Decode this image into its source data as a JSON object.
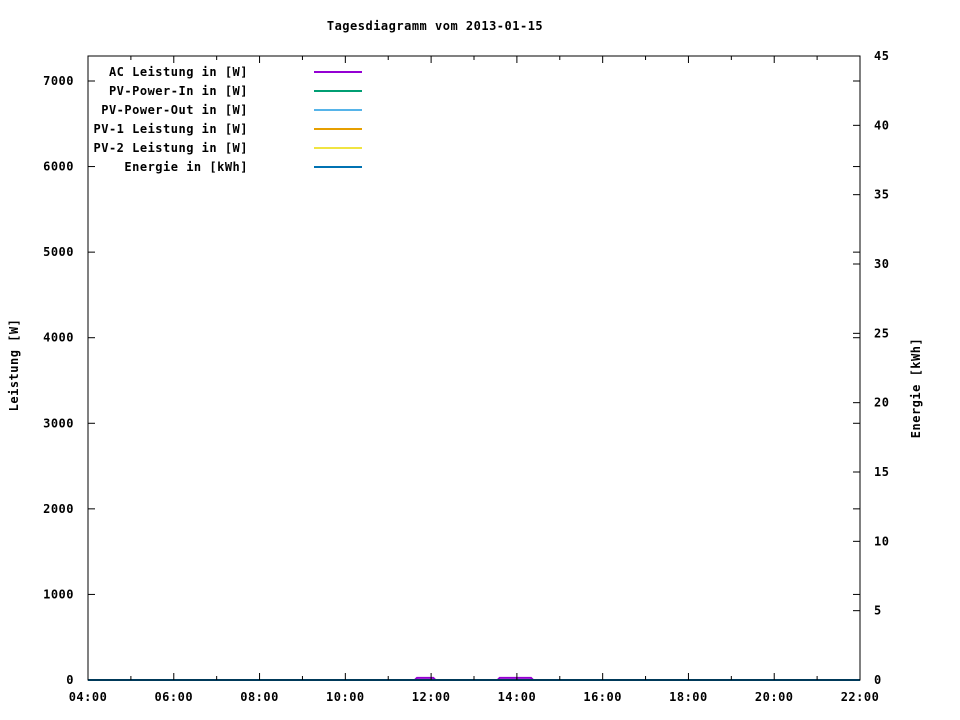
{
  "page": {
    "background": "#ffffff",
    "text_color": "#000000"
  },
  "chart_data": {
    "type": "line",
    "title": "Tagesdiagramm vom 2013-01-15",
    "ylabel": "Leistung [W]",
    "y2label": "Energie [kWh]",
    "grid": false,
    "legend_position": "top-left-inside",
    "x_axis": {
      "unit": "time",
      "start_hour": 4,
      "end_hour": 22,
      "major_step_hours": 2,
      "minor_step_hours": 1,
      "major_tick_labels": [
        "04:00",
        "06:00",
        "08:00",
        "10:00",
        "12:00",
        "14:00",
        "16:00",
        "18:00",
        "20:00",
        "22:00"
      ]
    },
    "y_axis": {
      "min": 0,
      "max": 7292,
      "tick_values": [
        0,
        1000,
        2000,
        3000,
        4000,
        5000,
        6000,
        7000
      ],
      "tick_labels": [
        "0",
        "1000",
        "2000",
        "3000",
        "4000",
        "5000",
        "6000",
        "7000"
      ]
    },
    "y2_axis": {
      "min": 0,
      "max": 45,
      "tick_values": [
        0,
        5,
        10,
        15,
        20,
        25,
        30,
        35,
        40,
        45
      ],
      "tick_labels": [
        "0",
        "5",
        "10",
        "15",
        "20",
        "25",
        "30",
        "35",
        "40",
        "45"
      ]
    },
    "series": [
      {
        "label": "AC Leistung in [W]",
        "color": "#9400d3",
        "axis": "y1",
        "points": [
          [
            4,
            0
          ],
          [
            11.62,
            0
          ],
          [
            11.67,
            25
          ],
          [
            12.05,
            25
          ],
          [
            12.1,
            0
          ],
          [
            13.55,
            0
          ],
          [
            13.6,
            25
          ],
          [
            14.33,
            25
          ],
          [
            14.38,
            0
          ],
          [
            22,
            0
          ]
        ]
      },
      {
        "label": "PV-Power-In in [W]",
        "color": "#009e73",
        "axis": "y1",
        "points": [
          [
            4,
            0
          ],
          [
            22,
            0
          ]
        ]
      },
      {
        "label": "PV-Power-Out in [W]",
        "color": "#56b4e9",
        "axis": "y1",
        "points": [
          [
            4,
            0
          ],
          [
            22,
            0
          ]
        ]
      },
      {
        "label": "PV-1 Leistung in [W]",
        "color": "#e69f00",
        "axis": "y1",
        "points": [
          [
            4,
            0
          ],
          [
            22,
            0
          ]
        ]
      },
      {
        "label": "PV-2 Leistung in [W]",
        "color": "#f0e442",
        "axis": "y1",
        "points": [
          [
            4,
            0
          ],
          [
            22,
            0
          ]
        ]
      },
      {
        "label": "Energie in [kWh]",
        "color": "#0072b2",
        "axis": "y2",
        "points": [
          [
            4,
            0
          ],
          [
            22,
            0
          ]
        ]
      }
    ]
  }
}
